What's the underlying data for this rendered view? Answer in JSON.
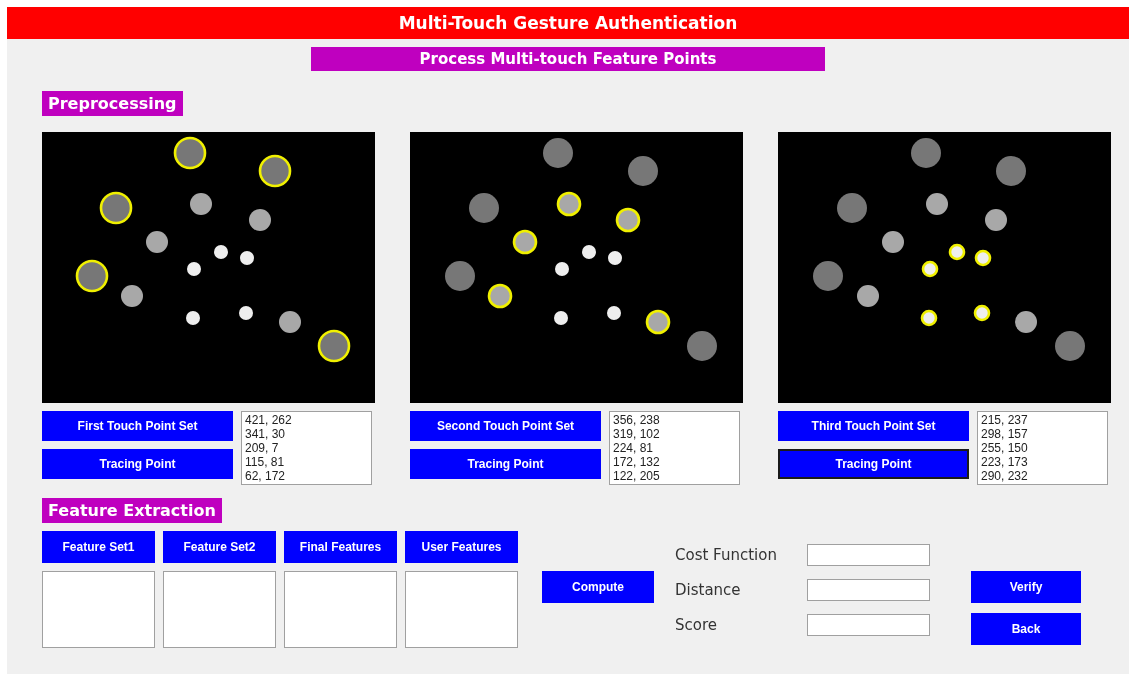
{
  "window": {
    "title": "Multi-Touch Gesture Authentication"
  },
  "subtitle": "Process Multi-touch Feature Points",
  "preprocessing": {
    "heading": "Preprocessing",
    "panels": [
      {
        "outer_highlighted": true,
        "middle_highlighted": false,
        "inner_highlighted": false,
        "set_button": "First Touch Point Set",
        "tracing_button": {
          "label": "Tracing Point",
          "focused": false
        },
        "points": [
          "421, 262",
          "341, 30",
          "209, 7",
          "115, 81",
          "62, 172"
        ]
      },
      {
        "outer_highlighted": false,
        "middle_highlighted": true,
        "inner_highlighted": false,
        "set_button": "Second Touch Point Set",
        "tracing_button": {
          "label": "Tracing Point",
          "focused": false
        },
        "points": [
          "356, 238",
          "319, 102",
          "224, 81",
          "172, 132",
          "122, 205"
        ]
      },
      {
        "outer_highlighted": false,
        "middle_highlighted": false,
        "inner_highlighted": true,
        "set_button": "Third Touch Point Set",
        "tracing_button": {
          "label": "Tracing Point",
          "focused": true
        },
        "points": [
          "215, 237",
          "298, 157",
          "255, 150",
          "223, 173",
          "290, 232"
        ]
      }
    ]
  },
  "feature_extraction": {
    "heading": "Feature Extraction",
    "sets": [
      "Feature Set1",
      "Feature Set2",
      "Final Features",
      "User Features"
    ],
    "compute_button": "Compute",
    "fields": [
      {
        "label": "Cost Function"
      },
      {
        "label": "Distance"
      },
      {
        "label": "Score"
      }
    ],
    "buttons": [
      "Verify",
      "Back"
    ]
  }
}
